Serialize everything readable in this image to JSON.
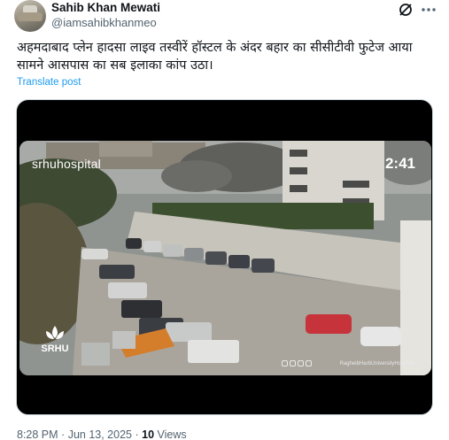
{
  "author": {
    "name": "Sahib Khan Mewati",
    "handle": "@iamsahibkhanmeo"
  },
  "post": {
    "text_line1": "अहमदाबाद प्लेन हादसा लाइव तस्वीरें हॉस्टल के अंदर बहार का सीसीटीवी फुटेज आया",
    "text_line2": "सामने आसपास का सब इलाका कांप उठा।",
    "translate_label": "Translate post"
  },
  "video": {
    "watermark": "srhuhospital",
    "timestamp": "2:41",
    "logo_text": "SRHU",
    "bottom_watermark": "RagheibHarbUniversityHospital"
  },
  "meta": {
    "time": "8:28 PM",
    "separator": "·",
    "date": "Jun 13, 2025",
    "views_count": "10",
    "views_label": "Views"
  },
  "icons": {
    "grok": "grok-icon",
    "more": "more-icon"
  }
}
